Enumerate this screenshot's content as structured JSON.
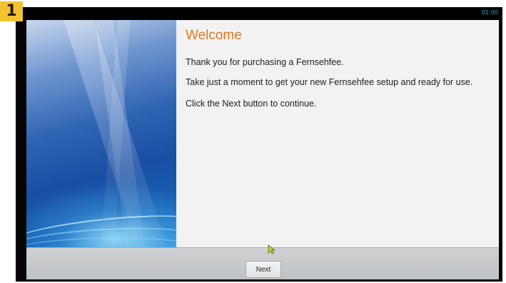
{
  "badge": {
    "number": "1"
  },
  "status_bar": {
    "clock": "01:00"
  },
  "welcome": {
    "title": "Welcome",
    "paragraphs": [
      "Thank you for purchasing a Fernsehfee.",
      "Take just a moment to get your new Fernsehfee setup and ready for use.",
      "Click the Next button to continue."
    ]
  },
  "footer": {
    "next_label": "Next"
  },
  "icons": {
    "badge_color": "#f2c230",
    "title_color": "#e0781e",
    "cursor": "pointer-cursor-icon"
  }
}
